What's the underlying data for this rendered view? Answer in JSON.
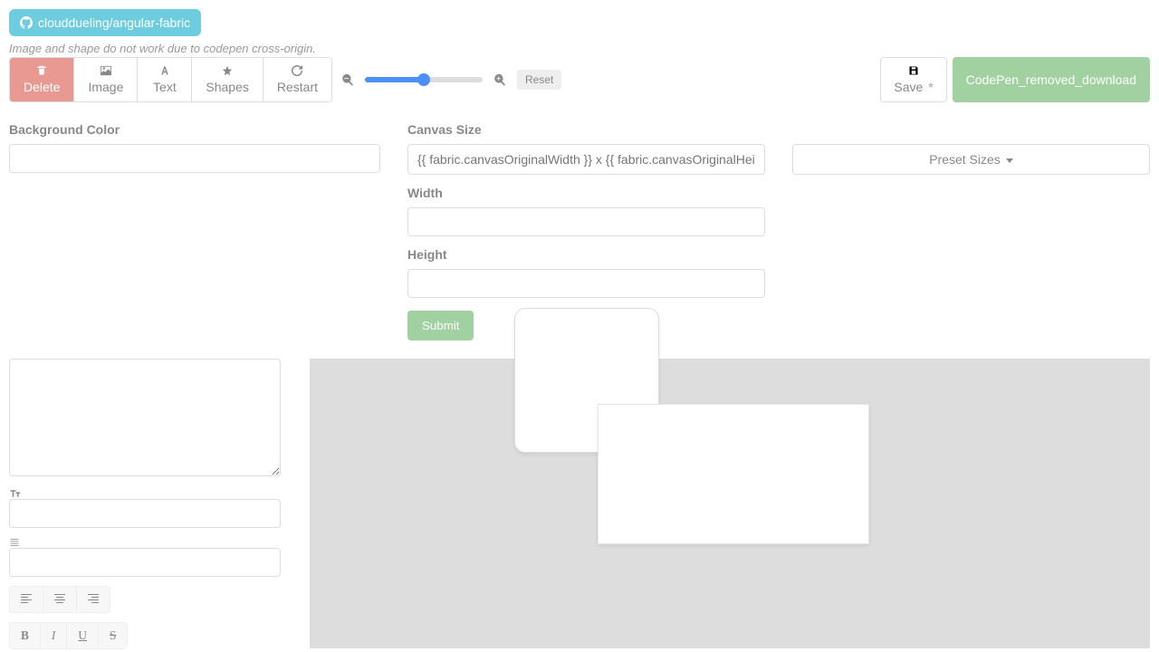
{
  "github": {
    "label": "clouddueling/angular-fabric"
  },
  "note": "Image and shape do not work due to codepen cross-origin.",
  "toolbar": {
    "delete": "Delete",
    "image": "Image",
    "text": "Text",
    "shapes": "Shapes",
    "restart": "Restart",
    "reset": "Reset",
    "save": "Save",
    "download": "CodePen_removed_download"
  },
  "zoom": {
    "min": 0,
    "max": 100,
    "value": 50
  },
  "bg": {
    "label": "Background Color",
    "value": ""
  },
  "canvas": {
    "label": "Canvas Size",
    "placeholder": "{{ fabric.canvasOriginalWidth }} x {{ fabric.canvasOriginalHeight }}",
    "preset": "Preset Sizes",
    "width_label": "Width",
    "width_value": "",
    "height_label": "Height",
    "height_value": "",
    "submit": "Submit"
  },
  "text_editor": {
    "content": "",
    "font_size_value": "",
    "line_height_value": ""
  },
  "style": {
    "bold": "B",
    "italic": "I",
    "under": "U",
    "strike": "S"
  }
}
